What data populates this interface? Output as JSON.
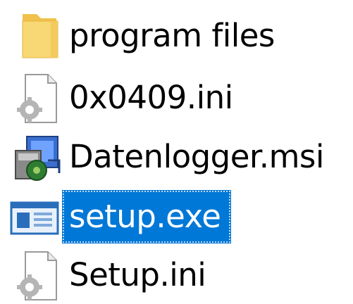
{
  "files": [
    {
      "name": "program files",
      "type": "folder",
      "icon": "folder-icon",
      "selected": false
    },
    {
      "name": "0x0409.ini",
      "type": "ini",
      "icon": "settings-file-icon",
      "selected": false
    },
    {
      "name": "Datenlogger.msi",
      "type": "msi",
      "icon": "installer-package-icon",
      "selected": false
    },
    {
      "name": "setup.exe",
      "type": "exe",
      "icon": "application-window-icon",
      "selected": true
    },
    {
      "name": "Setup.ini",
      "type": "ini",
      "icon": "settings-file-icon",
      "selected": false
    }
  ],
  "colors": {
    "selection": "#0078d7",
    "folder": "#f8d775",
    "text": "#000000",
    "selected_text": "#ffffff"
  }
}
